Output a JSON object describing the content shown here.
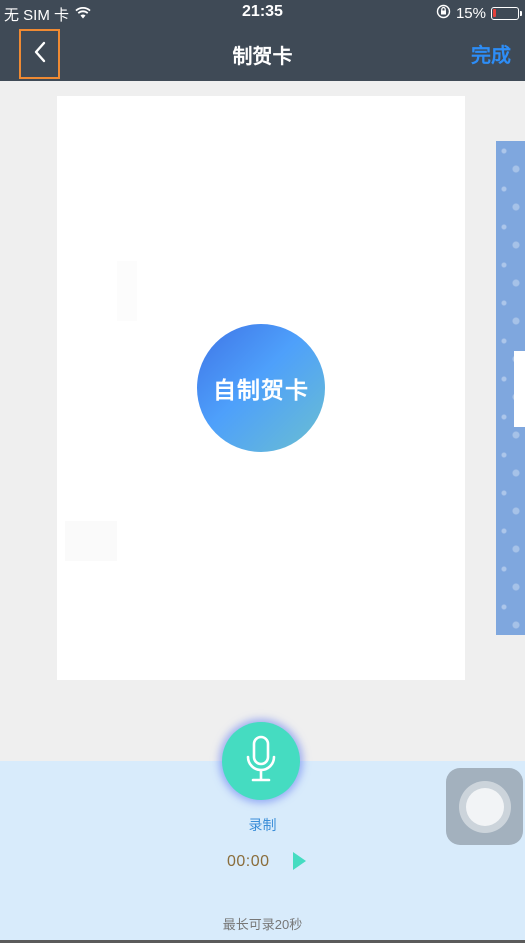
{
  "status_bar": {
    "carrier": "无 SIM 卡",
    "time": "21:35",
    "battery_text": "15%",
    "battery_level": 0.15,
    "battery_color": "#e5403a"
  },
  "nav": {
    "title": "制贺卡",
    "done_label": "完成",
    "back_icon": "chevron-left-icon",
    "accent": "#2d8df7"
  },
  "card": {
    "diy_label": "自制贺卡"
  },
  "recorder": {
    "record_label": "录制",
    "timer": "00:00",
    "limit_text": "最长可录20秒",
    "accent": "#45dcc1"
  }
}
